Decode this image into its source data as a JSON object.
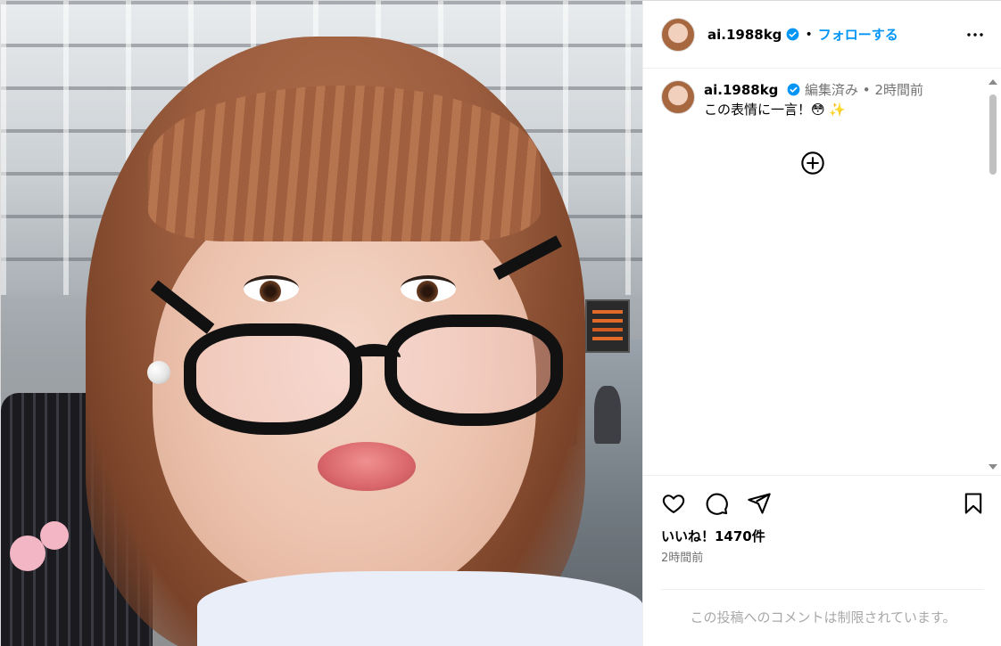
{
  "post": {
    "photo_label": "",
    "account": {
      "username": "ai.1988kg",
      "follow_label": "フォローする",
      "separator": "•"
    },
    "caption": {
      "username": "ai.1988kg",
      "edited_label": "編集済み",
      "separator": "•",
      "time_ago": "2時間前",
      "text": "この表情に一言！😳 ✨"
    },
    "likes_label": "いいね！1470件",
    "timestamp": "2時間前",
    "comments_restricted": "この投稿へのコメントは制限されています。"
  },
  "icons": {
    "verified": "verified-badge-icon",
    "more": "more-options-icon",
    "load_more": "plus-circle-icon",
    "like": "heart-icon",
    "comment": "comment-icon",
    "share": "share-icon",
    "save": "bookmark-icon",
    "scroll_up": "scroll-up-arrow-icon",
    "scroll_down": "scroll-down-arrow-icon"
  },
  "colors": {
    "link_blue": "#0095f6",
    "muted_text": "#737373",
    "placeholder_text": "#a8a8a8"
  }
}
